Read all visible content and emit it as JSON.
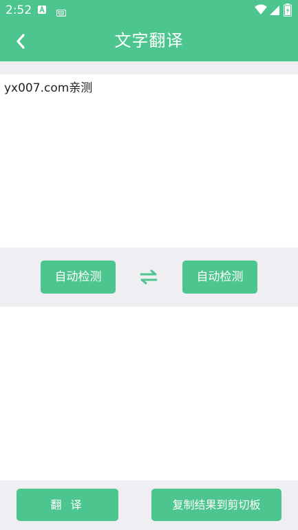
{
  "status_bar": {
    "time": "2:52",
    "icons": [
      "a-notification-icon",
      "keyboard-icon",
      "wifi-icon",
      "signal-icon",
      "battery-icon"
    ]
  },
  "header": {
    "title": "文字翻译",
    "back_icon": "chevron-left-icon"
  },
  "input": {
    "value": "yx007.com亲测",
    "placeholder": ""
  },
  "language_bar": {
    "source_label": "自动检测",
    "target_label": "自动检测",
    "swap_icon": "swap-arrows-icon"
  },
  "output": {
    "value": ""
  },
  "actions": {
    "translate_label": "翻 译",
    "copy_label": "复制结果到剪切板"
  },
  "colors": {
    "accent": "#4cc68e",
    "background_gray": "#efeff3",
    "text": "#222222"
  }
}
